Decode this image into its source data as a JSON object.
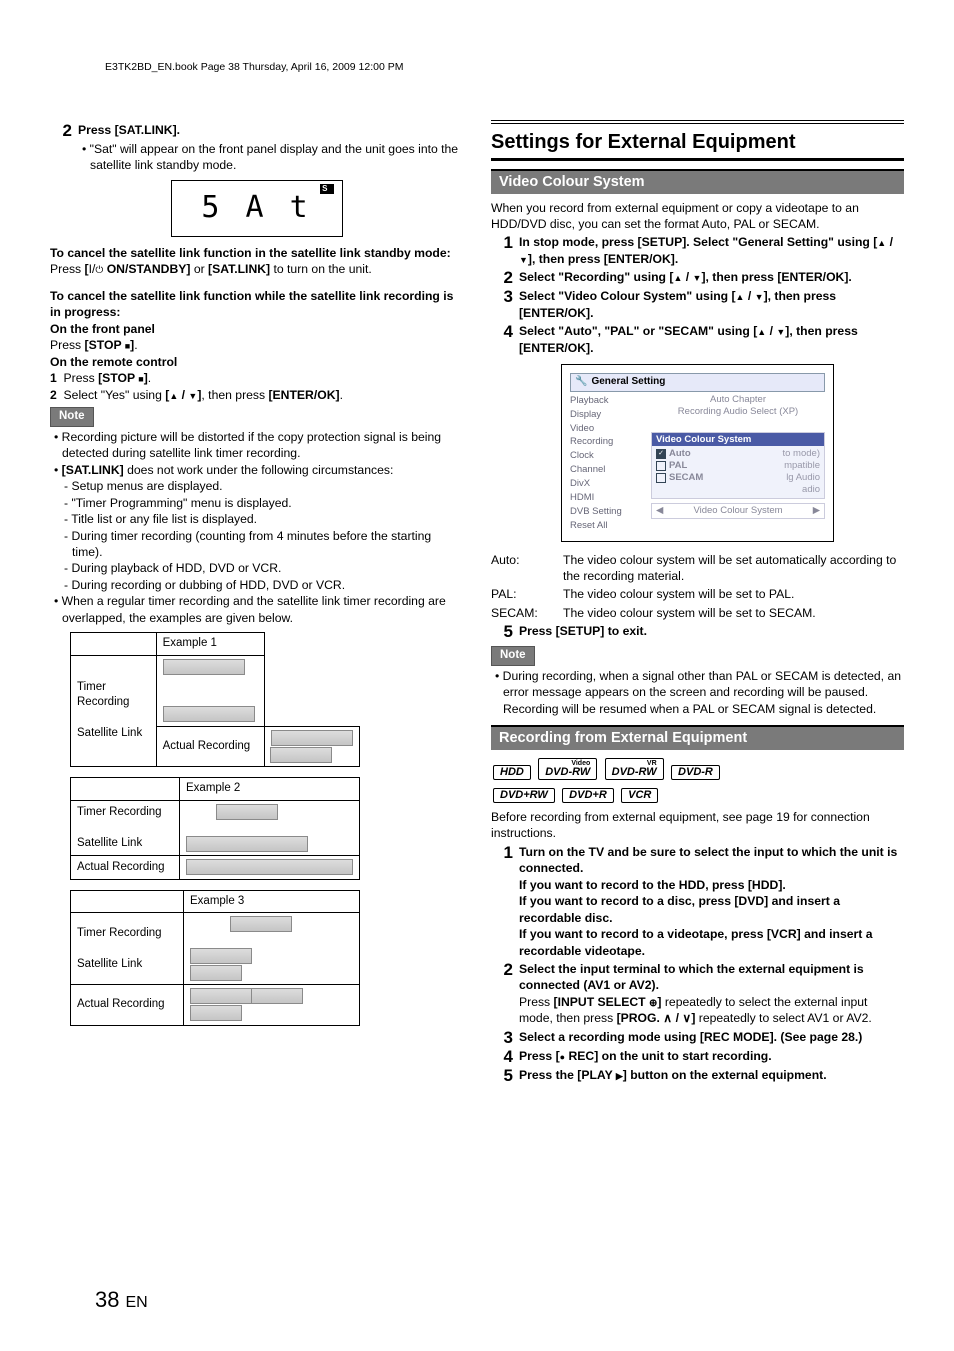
{
  "header": "E3TK2BD_EN.book  Page 38  Thursday, April 16, 2009  12:00 PM",
  "page_num": "38",
  "page_lang": "EN",
  "left": {
    "step2_num": "2",
    "step2_head": "Press [SAT.LINK].",
    "step2_bul": "\"Sat\" will appear on the front panel display and the unit goes into the satellite link standby mode.",
    "lcd_text": "5 A t",
    "lcd_badge": "S",
    "cancel_standby_h": "To cancel the satellite link function in the satellite link standby mode:",
    "cancel_standby_b": "Press [I/ON/STANDBY] or [SAT.LINK] to turn on the unit.",
    "cancel_inprog_h": "To cancel the satellite link function while the satellite link recording is in progress:",
    "front_panel_h": "On the front panel",
    "front_panel_b": "Press [STOP ■].",
    "remote_h": "On the remote control",
    "remote_1": "Press [STOP ■].",
    "remote_2": "Select \"Yes\" using [▲ / ▼], then press [ENTER/OK].",
    "note": "Note",
    "note1": "Recording picture will be distorted if the copy protection signal is being detected during satellite link timer recording.",
    "note2": "[SAT.LINK] does not work under the following circumstances:",
    "d1": "Setup menus are displayed.",
    "d2": "\"Timer Programming\" menu is displayed.",
    "d3": "Title list or any file list is displayed.",
    "d4": "During timer recording (counting from 4 minutes before the starting time).",
    "d5": "During playback of HDD, DVD or VCR.",
    "d6": "During recording or dubbing of HDD, DVD or VCR.",
    "note3": "When a regular timer recording and the satellite link timer recording are overlapped, the examples are given below.",
    "ex1": "Example 1",
    "ex2": "Example 2",
    "ex3": "Example 3",
    "row_tr": "Timer Recording",
    "row_sl": "Satellite Link",
    "row_ar": "Actual Recording"
  },
  "right": {
    "title": "Settings for External Equipment",
    "vcs_bar": "Video Colour System",
    "vcs_intro": "When you record from external equipment or copy a videotape to an HDD/DVD disc, you can set the format Auto, PAL or SECAM.",
    "s1n": "1",
    "s1": "In stop mode, press [SETUP]. Select \"General Setting\" using [▲ / ▼], then press [ENTER/OK].",
    "s2n": "2",
    "s2": "Select \"Recording\" using [▲ / ▼], then press [ENTER/OK].",
    "s3n": "3",
    "s3": "Select \"Video Colour System\" using [▲ / ▼], then press [ENTER/OK].",
    "s4n": "4",
    "s4": "Select \"Auto\", \"PAL\" or \"SECAM\" using [▲ / ▼], then press [ENTER/OK].",
    "menu": {
      "title": "General Setting",
      "items": [
        "Playback",
        "Display",
        "Video",
        "Recording",
        "Clock",
        "Channel",
        "DivX",
        "HDMI",
        "DVB Setting",
        "Reset All"
      ],
      "r_top1": "Auto Chapter",
      "r_top2": "Recording Audio Select (XP)",
      "box_title": "Video Colour System",
      "opt1": "Auto",
      "opt2": "PAL",
      "opt3": "SECAM",
      "foot": "Video Colour System",
      "ghost1": "to mode)",
      "ghost2": "mpatible",
      "ghost3": "lg Audio",
      "ghost4": "adio"
    },
    "def_auto_k": "Auto:",
    "def_auto_v": "The video colour system will be set automatically according to the recording material.",
    "def_pal_k": "PAL:",
    "def_pal_v": "The video colour system will be set to PAL.",
    "def_sec_k": "SECAM:",
    "def_sec_v": "The video colour system will be set to SECAM.",
    "s5n": "5",
    "s5": "Press [SETUP] to exit.",
    "note": "Note",
    "note_b": "During recording, when a signal other than PAL or SECAM is detected, an error message appears on the screen and recording will be paused. Recording will be resumed when a PAL or SECAM signal is detected.",
    "rec_bar": "Recording from External Equipment",
    "media": [
      "HDD",
      "DVD-RW",
      "DVD-RW",
      "DVD-R",
      "DVD+RW",
      "DVD+R",
      "VCR"
    ],
    "media_sup": [
      "",
      "Video",
      "VR",
      "",
      "",
      "",
      ""
    ],
    "rec_intro": "Before recording from external equipment, see page 19 for connection instructions.",
    "r1n": "1",
    "r1a": "Turn on the TV and be sure to select the input to which the unit is connected.",
    "r1b": "If you want to record to the HDD, press [HDD].",
    "r1c": "If you want to record to a disc, press [DVD] and insert a recordable disc.",
    "r1d": "If you want to record to a videotape, press [VCR] and insert a recordable videotape.",
    "r2n": "2",
    "r2a": "Select the input terminal to which the external equipment is connected (AV1 or AV2).",
    "r2b": "Press [INPUT SELECT ⊕] repeatedly to select the external input mode, then press [PROG. ∧ / ∨] repeatedly to select AV1 or AV2.",
    "r3n": "3",
    "r3": "Select a recording mode using [REC MODE]. (See page 28.)",
    "r4n": "4",
    "r4": "Press [● REC] on the unit to start recording.",
    "r5n": "5",
    "r5": "Press the [PLAY ▶] button on the external equipment."
  }
}
